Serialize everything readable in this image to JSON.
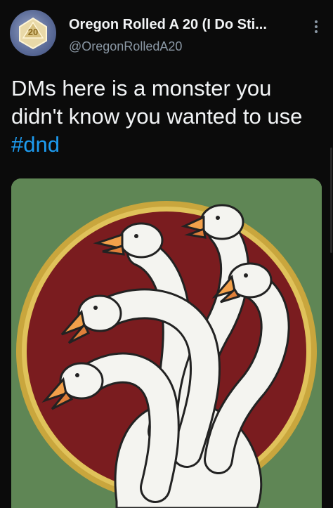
{
  "tweet": {
    "display_name": "Oregon Rolled A 20 (I Do Sti...",
    "handle": "@OregonRolledA20",
    "text_before": "DMs here is a monster you didn't know you wanted to use ",
    "hashtag": "#dnd"
  },
  "icons": {
    "avatar": "d20-avatar-icon",
    "more": "more-vertical-icon"
  },
  "colors": {
    "background": "#0b0b0b",
    "hashtag": "#1d9bf0",
    "handle": "#8b98a5",
    "media_background": "#5f8655",
    "medallion_red": "#7a1c1f",
    "medallion_ring": "#c9a63d",
    "beak": "#f2a04a"
  }
}
